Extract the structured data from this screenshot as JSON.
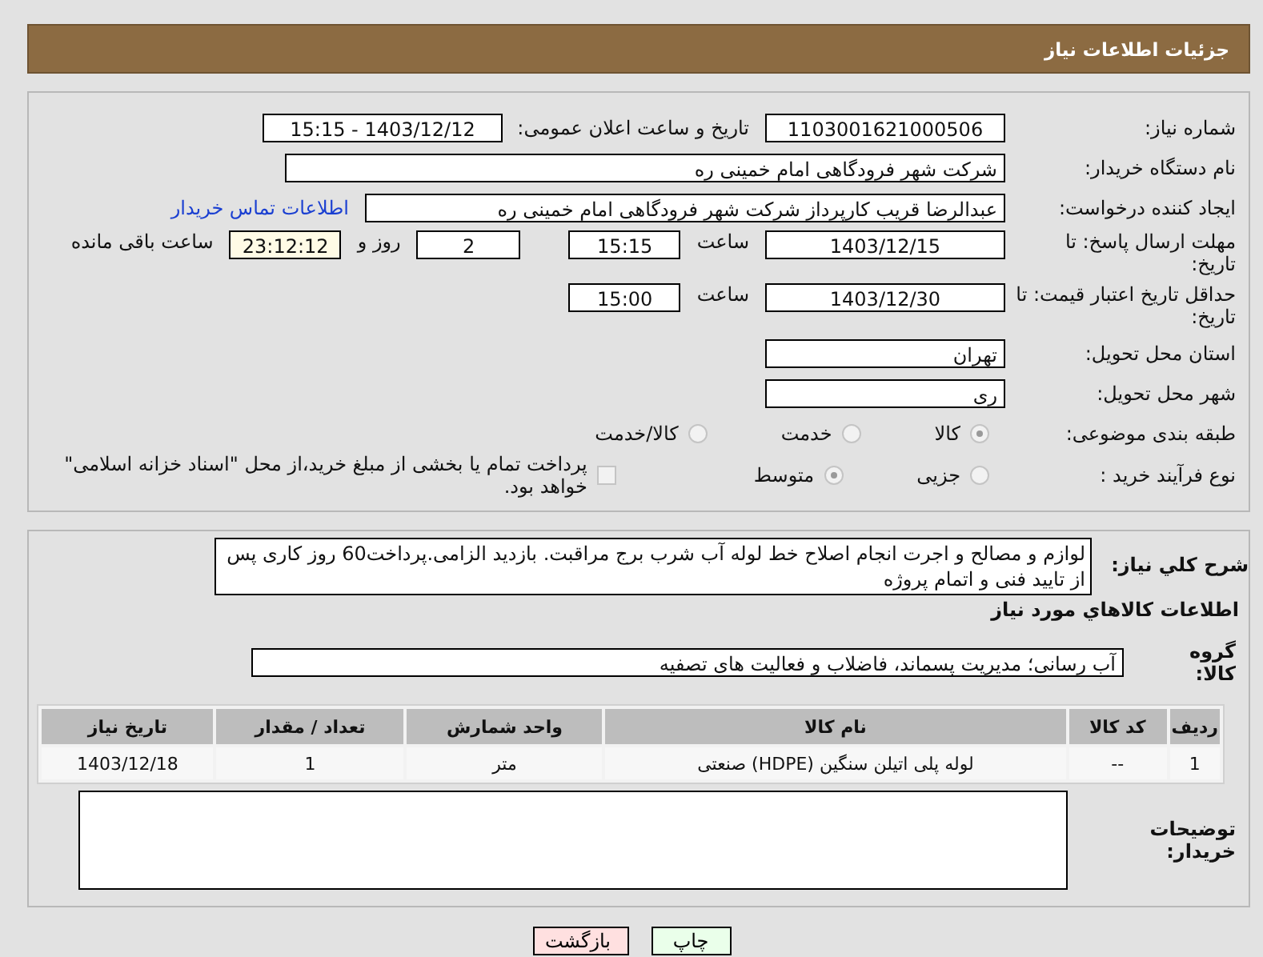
{
  "header": {
    "title": "جزئیات اطلاعات نیاز"
  },
  "need_number": {
    "label": "شماره نیاز:",
    "value": "1103001621000506"
  },
  "announce": {
    "label": "تاریخ و ساعت اعلان عمومی:",
    "value": "1403/12/12 - 15:15"
  },
  "buyer": {
    "label": "نام دستگاه خریدار:",
    "value": "شرکت شهر فرودگاهی امام خمینی  ره"
  },
  "requester": {
    "label": "ایجاد کننده درخواست:",
    "value": "عبدالرضا قریب کارپرداز شرکت شهر فرودگاهی امام خمینی  ره",
    "link": "اطلاعات تماس خریدار"
  },
  "deadline": {
    "label": "مهلت ارسال پاسخ: تا تاریخ:",
    "date": "1403/12/15",
    "time_label": "ساعت",
    "time": "15:15",
    "days": "2",
    "days_label": "روز و",
    "remaining": "23:12:12",
    "remaining_label": "ساعت باقی مانده"
  },
  "validity": {
    "label": "حداقل تاریخ اعتبار قیمت: تا تاریخ:",
    "date": "1403/12/30",
    "time_label": "ساعت",
    "time": "15:00"
  },
  "province": {
    "label": "استان محل تحویل:",
    "value": "تهران"
  },
  "city": {
    "label": "شهر محل تحویل:",
    "value": "ری"
  },
  "category": {
    "label": "طبقه بندی موضوعی:",
    "options": [
      {
        "label": "کالا",
        "selected": true
      },
      {
        "label": "خدمت",
        "selected": false
      },
      {
        "label": "کالا/خدمت",
        "selected": false
      }
    ]
  },
  "process": {
    "label": "نوع فرآیند خرید :",
    "options": [
      {
        "label": "جزیی",
        "selected": false
      },
      {
        "label": "متوسط",
        "selected": true
      }
    ],
    "payment": {
      "checked": false,
      "label": "پرداخت تمام یا بخشی از مبلغ خرید،از محل \"اسناد خزانه اسلامی\" خواهد بود."
    }
  },
  "description": {
    "label": "شرح کلي نياز:",
    "value": "لوازم و مصالح و اجرت انجام اصلاح خط لوله آب شرب برج مراقبت. بازدید الزامی.پرداخت60 روز کاری پس از تایید فنی و اتمام پروژه"
  },
  "goods_title": "اطلاعات کالاهاي مورد نياز",
  "goods_group": {
    "label": "گروه کالا:",
    "value": "آب رسانی؛ مدیریت پسماند، فاضلاب و فعالیت های تصفیه"
  },
  "table": {
    "columns": [
      "ردیف",
      "کد کالا",
      "نام کالا",
      "واحد شمارش",
      "تعداد / مقدار",
      "تاریخ نیاز"
    ],
    "rows": [
      [
        "1",
        "--",
        "لوله پلی اتیلن سنگین (HDPE) صنعتی",
        "متر",
        "1",
        "1403/12/18"
      ]
    ]
  },
  "notes": {
    "label": "توضیحات خریدار:"
  },
  "buttons": [
    {
      "label": "چاپ",
      "kind": "print"
    },
    {
      "label": "بازگشت",
      "kind": "back"
    }
  ]
}
